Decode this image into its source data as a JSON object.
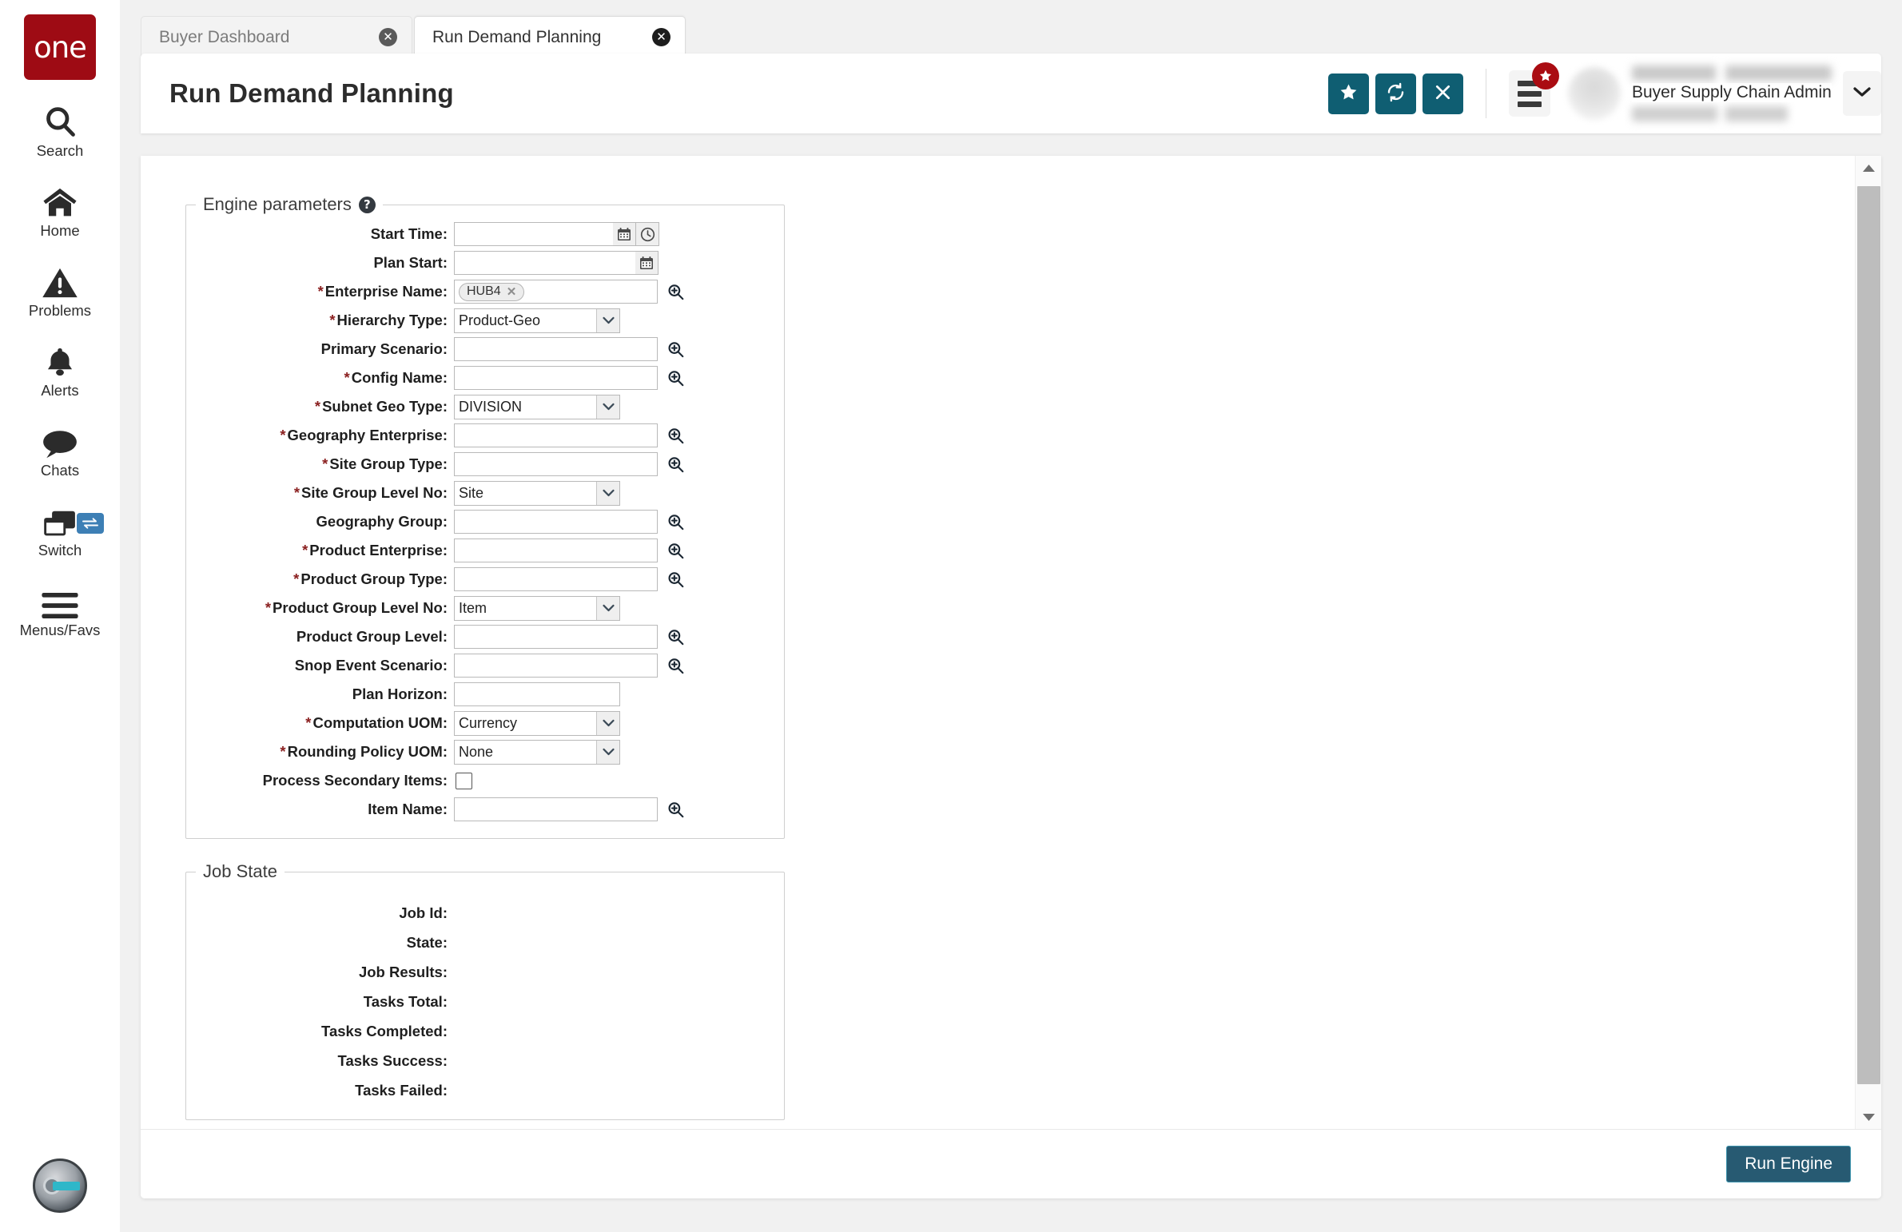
{
  "brand": {
    "logo_text": "one",
    "logo_color": "#9e0b14",
    "accent_color": "#0f5e72"
  },
  "rail": {
    "items": [
      {
        "label": "Search",
        "icon": "search-icon"
      },
      {
        "label": "Home",
        "icon": "home-icon"
      },
      {
        "label": "Problems",
        "icon": "warning-triangle-icon"
      },
      {
        "label": "Alerts",
        "icon": "bell-icon"
      },
      {
        "label": "Chats",
        "icon": "chat-bubble-icon"
      },
      {
        "label": "Switch",
        "icon": "windows-stack-icon",
        "badge_icon": "swap-arrows-icon"
      },
      {
        "label": "Menus/Favs",
        "icon": "hamburger-icon"
      }
    ],
    "bottom_widget": "ai-assistant-avatar"
  },
  "tabs": [
    {
      "label": "Buyer Dashboard",
      "active": false,
      "close_icon": "close-circle-icon"
    },
    {
      "label": "Run Demand Planning",
      "active": true,
      "close_icon": "close-circle-icon"
    }
  ],
  "header": {
    "title": "Run Demand Planning",
    "actions": [
      {
        "name": "favorite-button",
        "icon": "star-icon"
      },
      {
        "name": "refresh-button",
        "icon": "refresh-icon"
      },
      {
        "name": "close-button",
        "icon": "x-icon"
      }
    ],
    "menu_button": {
      "icon": "menu-list-icon",
      "badge_icon": "star-icon",
      "badge_color": "#aa0c12"
    },
    "user": {
      "role": "Buyer Supply Chain Admin",
      "caret_icon": "chevron-down-icon",
      "avatar": "user-avatar"
    }
  },
  "form": {
    "legend": "Engine parameters",
    "help_icon": "help-circle-icon",
    "fields": [
      {
        "label": "Start Time",
        "required": false,
        "type": "datetime",
        "value": "",
        "adornments": [
          "calendar-icon",
          "clock-icon"
        ]
      },
      {
        "label": "Plan Start",
        "required": false,
        "type": "date",
        "value": "",
        "adornments": [
          "calendar-icon"
        ]
      },
      {
        "label": "Enterprise Name",
        "required": true,
        "type": "chips",
        "chips": [
          "HUB4"
        ],
        "lookup": "zoom-in-icon"
      },
      {
        "label": "Hierarchy Type",
        "required": true,
        "type": "select",
        "value": "Product-Geo"
      },
      {
        "label": "Primary Scenario",
        "required": false,
        "type": "lookup",
        "value": "",
        "lookup": "zoom-in-icon"
      },
      {
        "label": "Config Name",
        "required": true,
        "type": "lookup",
        "value": "",
        "lookup": "zoom-in-icon"
      },
      {
        "label": "Subnet Geo Type",
        "required": true,
        "type": "select",
        "value": "DIVISION"
      },
      {
        "label": "Geography Enterprise",
        "required": true,
        "type": "lookup",
        "value": "",
        "lookup": "zoom-in-icon"
      },
      {
        "label": "Site Group Type",
        "required": true,
        "type": "lookup",
        "value": "",
        "lookup": "zoom-in-icon"
      },
      {
        "label": "Site Group Level No",
        "required": true,
        "type": "select",
        "value": "Site"
      },
      {
        "label": "Geography Group",
        "required": false,
        "type": "lookup",
        "value": "",
        "lookup": "zoom-in-icon"
      },
      {
        "label": "Product Enterprise",
        "required": true,
        "type": "lookup",
        "value": "",
        "lookup": "zoom-in-icon"
      },
      {
        "label": "Product Group Type",
        "required": true,
        "type": "lookup",
        "value": "",
        "lookup": "zoom-in-icon"
      },
      {
        "label": "Product Group Level No",
        "required": true,
        "type": "select",
        "value": "Item"
      },
      {
        "label": "Product Group Level",
        "required": false,
        "type": "lookup",
        "value": "",
        "lookup": "zoom-in-icon"
      },
      {
        "label": "Snop Event Scenario",
        "required": false,
        "type": "lookup",
        "value": "",
        "lookup": "zoom-in-icon"
      },
      {
        "label": "Plan Horizon",
        "required": false,
        "type": "text",
        "value": ""
      },
      {
        "label": "Computation UOM",
        "required": true,
        "type": "select",
        "value": "Currency"
      },
      {
        "label": "Rounding Policy UOM",
        "required": true,
        "type": "select",
        "value": "None"
      },
      {
        "label": "Process Secondary Items",
        "required": false,
        "type": "checkbox",
        "checked": false
      },
      {
        "label": "Item Name",
        "required": false,
        "type": "lookup",
        "value": "",
        "lookup": "zoom-in-icon"
      }
    ]
  },
  "job_state": {
    "legend": "Job State",
    "rows": [
      {
        "label": "Job Id",
        "value": ""
      },
      {
        "label": "State",
        "value": ""
      },
      {
        "label": "Job Results",
        "value": ""
      },
      {
        "label": "Tasks Total",
        "value": ""
      },
      {
        "label": "Tasks Completed",
        "value": ""
      },
      {
        "label": "Tasks Success",
        "value": ""
      },
      {
        "label": "Tasks Failed",
        "value": ""
      }
    ]
  },
  "footer": {
    "run_label": "Run Engine"
  },
  "scrollbar": {
    "up_icon": "triangle-up-icon",
    "down_icon": "triangle-down-icon"
  }
}
